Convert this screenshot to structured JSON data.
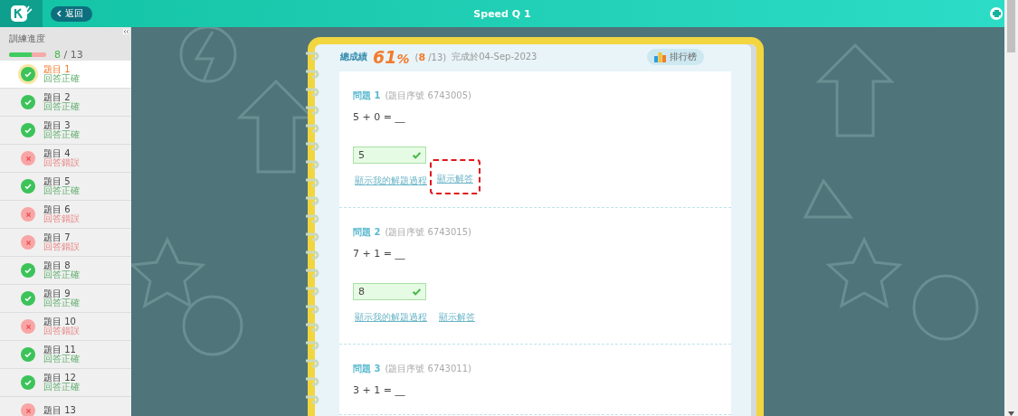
{
  "header": {
    "back_label": "返回",
    "title": "Speed Q 1"
  },
  "sidebar": {
    "progress_label": "訓練進度",
    "progress": {
      "level": 0.615,
      "done": "8",
      "total": "/ 13"
    },
    "items": [
      {
        "title": "題目 1",
        "status": "回答正確",
        "correct": true,
        "selected": true
      },
      {
        "title": "題目 2",
        "status": "回答正確",
        "correct": true,
        "selected": false
      },
      {
        "title": "題目 3",
        "status": "回答正確",
        "correct": true,
        "selected": false
      },
      {
        "title": "題目 4",
        "status": "回答錯誤",
        "correct": false,
        "selected": false
      },
      {
        "title": "題目 5",
        "status": "回答正確",
        "correct": true,
        "selected": false
      },
      {
        "title": "題目 6",
        "status": "回答錯誤",
        "correct": false,
        "selected": false
      },
      {
        "title": "題目 7",
        "status": "回答錯誤",
        "correct": false,
        "selected": false
      },
      {
        "title": "題目 8",
        "status": "回答正確",
        "correct": true,
        "selected": false
      },
      {
        "title": "題目 9",
        "status": "回答正確",
        "correct": true,
        "selected": false
      },
      {
        "title": "題目 10",
        "status": "回答錯誤",
        "correct": false,
        "selected": false
      },
      {
        "title": "題目 11",
        "status": "回答正確",
        "correct": true,
        "selected": false
      },
      {
        "title": "題目 12",
        "status": "回答正確",
        "correct": true,
        "selected": false
      },
      {
        "title": "題目 13",
        "correct": false,
        "selected": false
      }
    ]
  },
  "summary": {
    "label": "總成績",
    "score": "61",
    "unit": "%",
    "fraction": "(**8** /13)",
    "completed": "完成於04-Sep-2023",
    "leaderboard": "排行榜"
  },
  "questions": [
    {
      "title": "問題 1",
      "serial": "(題目序號 6743005)",
      "equation": "5 + 0 = __",
      "answer": "5",
      "correct": true,
      "links": [
        {
          "label": "顯示我的解題過程",
          "highlighted": false
        },
        {
          "label": "顯示解答",
          "highlighted": true
        }
      ]
    },
    {
      "title": "問題 2",
      "serial": "(題目序號 6743015)",
      "equation": "7 + 1 = __",
      "answer": "8",
      "correct": true,
      "links": [
        {
          "label": "顯示我的解題過程",
          "highlighted": false
        },
        {
          "label": "顯示解答",
          "highlighted": false
        }
      ]
    },
    {
      "title": "問題 3",
      "serial": "(題目序號 6743011)",
      "equation": "3 + 1 = __"
    }
  ]
}
